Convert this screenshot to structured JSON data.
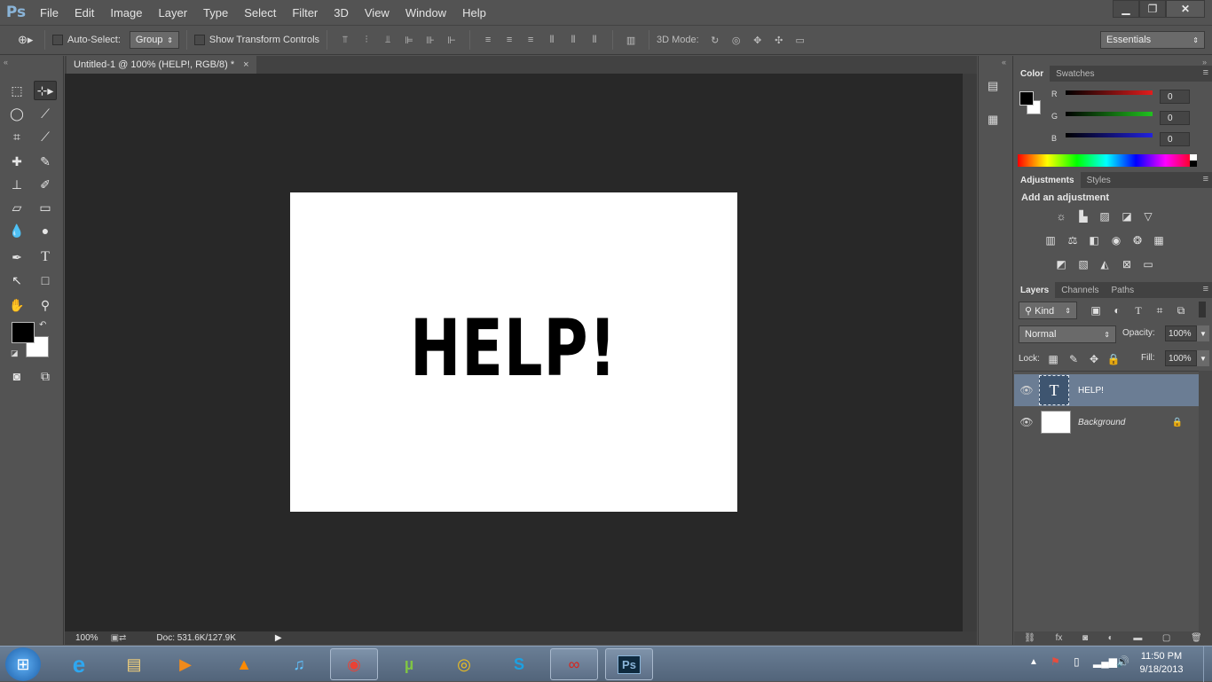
{
  "app": {
    "logo": "Ps"
  },
  "menu": [
    "File",
    "Edit",
    "Image",
    "Layer",
    "Type",
    "Select",
    "Filter",
    "3D",
    "View",
    "Window",
    "Help"
  ],
  "options": {
    "auto_select_label": "Auto-Select:",
    "auto_select_value": "Group",
    "show_transform_label": "Show Transform Controls",
    "mode3d_label": "3D Mode:",
    "workspace": "Essentials"
  },
  "document": {
    "tab_title": "Untitled-1 @ 100% (HELP!, RGB/8) *",
    "tab_close": "×",
    "canvas_text": "HELP!",
    "zoom": "100%",
    "doc_info": "Doc: 531.6K/127.9K"
  },
  "color_panel": {
    "tabs": [
      "Color",
      "Swatches"
    ],
    "channels": [
      {
        "label": "R",
        "value": "0",
        "color": "#e21d1d"
      },
      {
        "label": "G",
        "value": "0",
        "color": "#21c21f"
      },
      {
        "label": "B",
        "value": "0",
        "color": "#2222e0"
      }
    ]
  },
  "adjustments_panel": {
    "tabs": [
      "Adjustments",
      "Styles"
    ],
    "heading": "Add an adjustment"
  },
  "layers_panel": {
    "tabs": [
      "Layers",
      "Channels",
      "Paths"
    ],
    "filter_kind": "Kind",
    "blend_mode": "Normal",
    "opacity_label": "Opacity:",
    "opacity_value": "100%",
    "lock_label": "Lock:",
    "fill_label": "Fill:",
    "fill_value": "100%",
    "layers": [
      {
        "name": "HELP!",
        "type": "text",
        "selected": true
      },
      {
        "name": "Background",
        "type": "image",
        "selected": false,
        "locked": true
      }
    ]
  },
  "taskbar": {
    "time": "11:50 PM",
    "date": "9/18/2013"
  },
  "colors": {
    "ui_bg": "#535353",
    "canvas_bg": "#282828",
    "selection": "#6b7d94",
    "ps_blue": "#8ab4d8"
  }
}
